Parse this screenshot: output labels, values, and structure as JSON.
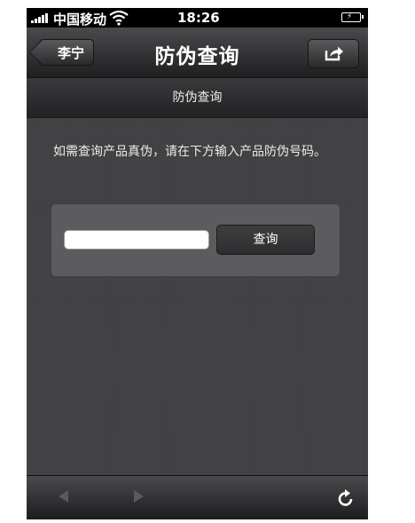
{
  "status_bar": {
    "carrier": "中国移动",
    "time": "18:26",
    "icons": [
      "signal-icon",
      "wifi-icon",
      "battery-charging-icon"
    ]
  },
  "navbar": {
    "back_label": "李宁",
    "title": "防伪查询",
    "share_icon": "share-icon"
  },
  "subheader": {
    "title": "防伪查询"
  },
  "main": {
    "instructions": "如需查询产品真伪，请在下方输入产品防伪号码。",
    "code_input": {
      "value": "",
      "placeholder": ""
    },
    "query_button": "查询"
  },
  "toolbar": {
    "icons": [
      "back-arrow-icon",
      "forward-arrow-icon",
      "refresh-icon"
    ]
  },
  "colors": {
    "background": "#414143",
    "panel": "#5c5c5e",
    "bar_dark": "#1f1f21",
    "text": "#ffffff"
  }
}
